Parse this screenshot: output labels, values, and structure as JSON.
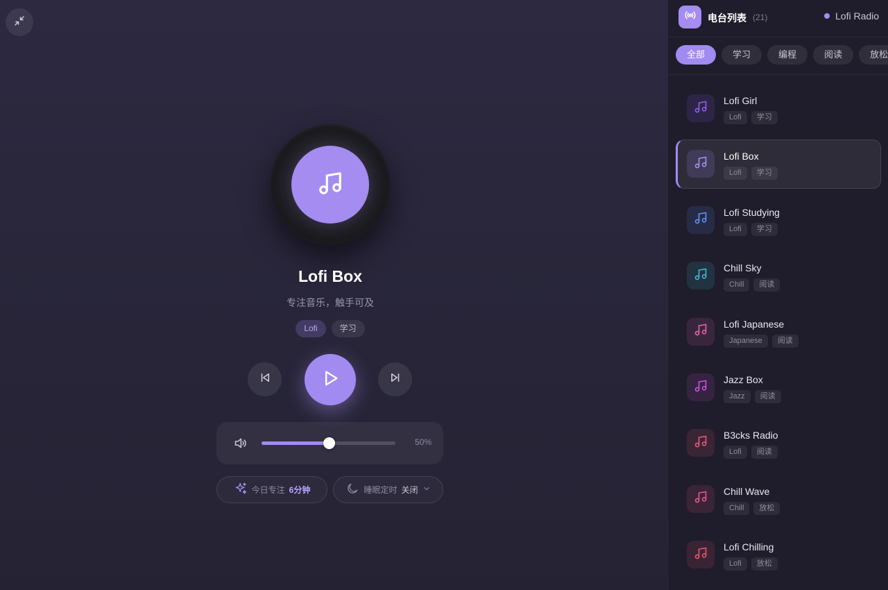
{
  "player": {
    "collapse_icon": "collapse-arrows-icon",
    "disc_icon": "music-note-icon",
    "title": "Lofi Box",
    "subtitle": "专注音乐，触手可及",
    "tags": [
      "Lofi",
      "学习"
    ],
    "controls": {
      "prev_icon": "skip-previous-icon",
      "play_icon": "play-icon",
      "next_icon": "skip-next-icon"
    },
    "volume": {
      "icon": "volume-icon",
      "level": 0.5,
      "label": "50%"
    },
    "focus": {
      "icon": "sparkle-icon",
      "label": "今日专注",
      "value": "6分钟"
    },
    "sleep_timer": {
      "icon": "moon-icon",
      "label": "睡眠定时",
      "value": "关闭",
      "chevron_icon": "chevron-down-icon"
    }
  },
  "stations_panel": {
    "icon": "radio-broadcast-icon",
    "title": "电台列表",
    "count": "(21)",
    "brand": "Lofi Radio",
    "filters": [
      {
        "label": "全部",
        "active": true
      },
      {
        "label": "学习",
        "active": false
      },
      {
        "label": "编程",
        "active": false
      },
      {
        "label": "阅读",
        "active": false
      },
      {
        "label": "放松",
        "active": false
      }
    ],
    "stations": [
      {
        "name": "Lofi Girl",
        "tags": [
          "Lofi",
          "学习"
        ],
        "icon": "music-note-icon",
        "color": "#8a5cf0",
        "active": false
      },
      {
        "name": "Lofi Box",
        "tags": [
          "Lofi",
          "学习"
        ],
        "icon": "music-note-icon",
        "color": "#a48cf0",
        "active": true
      },
      {
        "name": "Lofi Studying",
        "tags": [
          "Lofi",
          "学习"
        ],
        "icon": "music-note-icon",
        "color": "#5b8ef0",
        "active": false
      },
      {
        "name": "Chill Sky",
        "tags": [
          "Chill",
          "阅读"
        ],
        "icon": "music-note-icon",
        "color": "#3fb6cf",
        "active": false
      },
      {
        "name": "Lofi Japanese",
        "tags": [
          "Japanese",
          "阅读"
        ],
        "icon": "music-note-icon",
        "color": "#e060a8",
        "active": false
      },
      {
        "name": "Jazz Box",
        "tags": [
          "Jazz",
          "阅读"
        ],
        "icon": "music-note-icon",
        "color": "#c64fd8",
        "active": false
      },
      {
        "name": "B3cks Radio",
        "tags": [
          "Lofi",
          "阅读"
        ],
        "icon": "music-note-icon",
        "color": "#e05a7a",
        "active": false
      },
      {
        "name": "Chill Wave",
        "tags": [
          "Chill",
          "放松"
        ],
        "icon": "music-note-icon",
        "color": "#e0568a",
        "active": false
      },
      {
        "name": "Lofi Chilling",
        "tags": [
          "Lofi",
          "放松"
        ],
        "icon": "music-note-icon",
        "color": "#e0566a",
        "active": false
      }
    ]
  }
}
